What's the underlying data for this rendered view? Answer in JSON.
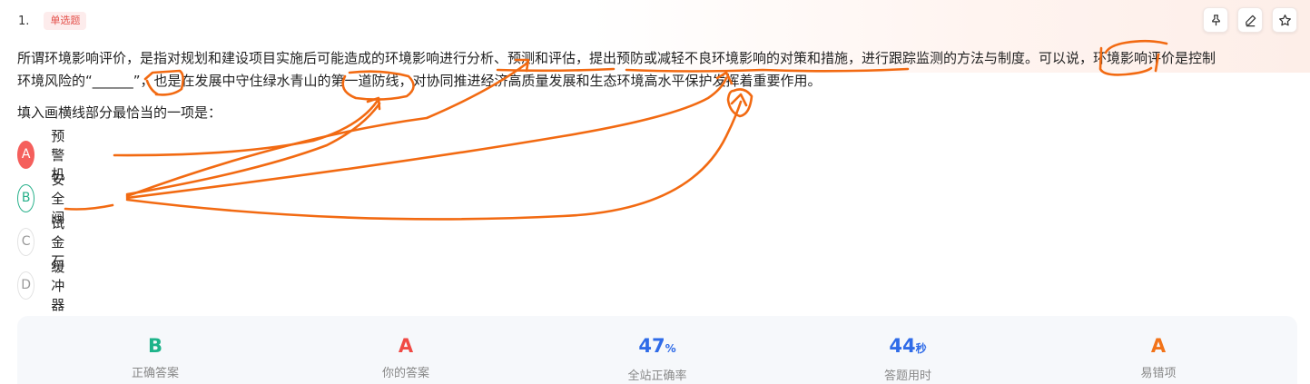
{
  "question": {
    "number": "1.",
    "type_badge": "单选题",
    "stem_line1": "所谓环境影响评价，是指对规划和建设项目实施后可能造成的环境影响进行分析、预测和评估，提出预防或减轻不良环境影响的对策和措施，进行跟踪监测的方法与制度。可以说，环境影响评价是控制",
    "stem_line2": "环境风险的“______”，也是在发展中守住绿水青山的第一道防线，对协同推进经济高质量发展和生态环境高水平保护发挥着重要作用。",
    "prompt": "填入画横线部分最恰当的一项是："
  },
  "actions": [
    {
      "name": "pin-icon"
    },
    {
      "name": "edit-icon"
    },
    {
      "name": "star-icon"
    }
  ],
  "options": [
    {
      "letter": "A",
      "text": "预警机",
      "state": "wrong"
    },
    {
      "letter": "B",
      "text": "安全阀",
      "state": "correct"
    },
    {
      "letter": "C",
      "text": "试金石",
      "state": "normal"
    },
    {
      "letter": "D",
      "text": "缓冲器",
      "state": "normal"
    }
  ],
  "stats": {
    "correct_answer": {
      "value": "B",
      "label": "正确答案",
      "color": "#1db38a"
    },
    "your_answer": {
      "value": "A",
      "label": "你的答案",
      "color": "#f04a45"
    },
    "accuracy": {
      "value": "47",
      "unit": "%",
      "label": "全站正确率",
      "color": "#2f6be8"
    },
    "time_used": {
      "value": "44",
      "unit": "秒",
      "label": "答题用时",
      "color": "#2f6be8"
    },
    "common_wrong": {
      "value": "A",
      "label": "易错项",
      "color": "#f27319"
    }
  },
  "colors": {
    "badge_text": "#e4514b",
    "annotation_ink": "#f26a12"
  }
}
